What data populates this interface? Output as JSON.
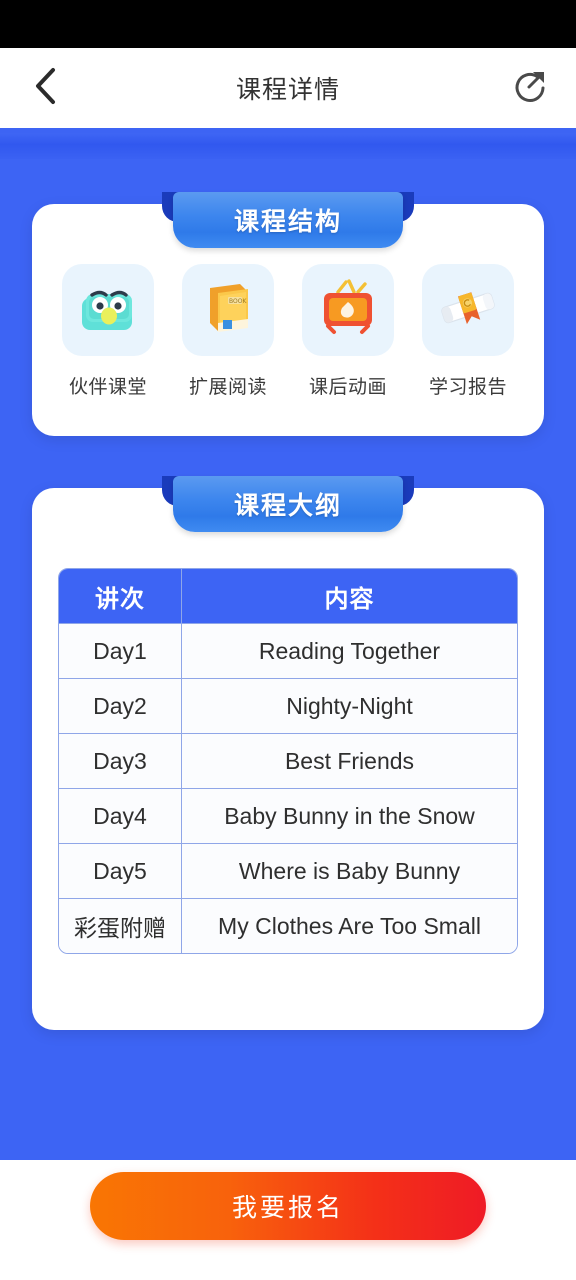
{
  "nav": {
    "title": "课程详情",
    "back_icon": "chevron-left-icon",
    "share_icon": "share-circle-icon"
  },
  "structure_section": {
    "banner_title": "课程结构",
    "items": [
      {
        "label": "伙伴课堂",
        "icon": "owl-classroom-icon"
      },
      {
        "label": "扩展阅读",
        "icon": "book-icon"
      },
      {
        "label": "课后动画",
        "icon": "tv-animation-icon"
      },
      {
        "label": "学习报告",
        "icon": "diploma-scroll-icon"
      }
    ]
  },
  "outline_section": {
    "banner_title": "课程大纲",
    "table": {
      "headers": [
        "讲次",
        "内容"
      ],
      "rows": [
        [
          "Day1",
          "Reading Together"
        ],
        [
          "Day2",
          "Nighty-Night"
        ],
        [
          "Day3",
          "Best Friends"
        ],
        [
          "Day4",
          "Baby Bunny in the Snow"
        ],
        [
          "Day5",
          "Where is Baby Bunny"
        ],
        [
          "彩蛋附赠",
          "My Clothes Are Too Small"
        ]
      ]
    }
  },
  "footer": {
    "cta_label": "我要报名"
  },
  "colors": {
    "page_blue": "#3d64f4",
    "banner_blue": "#3d86ee",
    "banner_tail": "#1a3bbb",
    "cta_start": "#f97603",
    "cta_end": "#ef1b26",
    "tile_bg": "#e9f4fd",
    "table_border": "#8fa6e8"
  }
}
